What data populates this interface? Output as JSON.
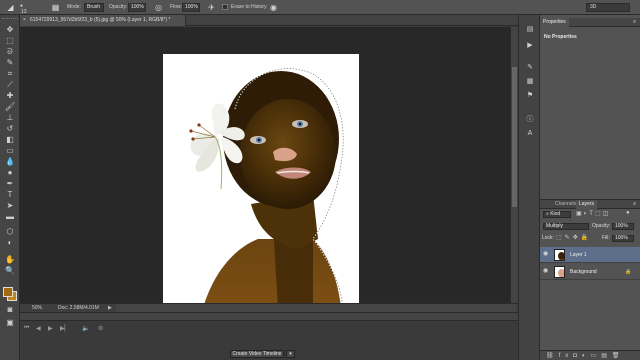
{
  "options_bar": {
    "brush_size": "13",
    "mode_label": "Mode:",
    "mode_value": "Brush",
    "opacity_label": "Opacity:",
    "opacity_value": "100%",
    "flow_label": "Flow:",
    "flow_value": "100%",
    "erase_history_label": "Erase to History",
    "workspace_value": "3D"
  },
  "document": {
    "tab_title": "6154729913_957d2b5f23_b (5).jpg @ 50% (Layer 1, RGB/8*) *",
    "zoom": "50%",
    "doc_info": "Doc: 2.58M/4.01M"
  },
  "timeline": {
    "create_button": "Create Video Timeline"
  },
  "properties": {
    "tab_label": "Properties",
    "empty_text": "No Properties"
  },
  "layers_panel": {
    "tabs": [
      "Channels",
      "Layers"
    ],
    "filter_kind": "Kind",
    "blend_mode": "Multiply",
    "opacity_label": "Opacity:",
    "opacity_value": "100%",
    "lock_label": "Lock:",
    "fill_label": "Fill:",
    "fill_value": "100%",
    "layers": [
      {
        "name": "Layer 1",
        "selected": true
      },
      {
        "name": "Background",
        "selected": false
      }
    ]
  },
  "colors": {
    "foreground": "#a06a12",
    "background": "#c08420",
    "selection": "#5d6f8a"
  }
}
